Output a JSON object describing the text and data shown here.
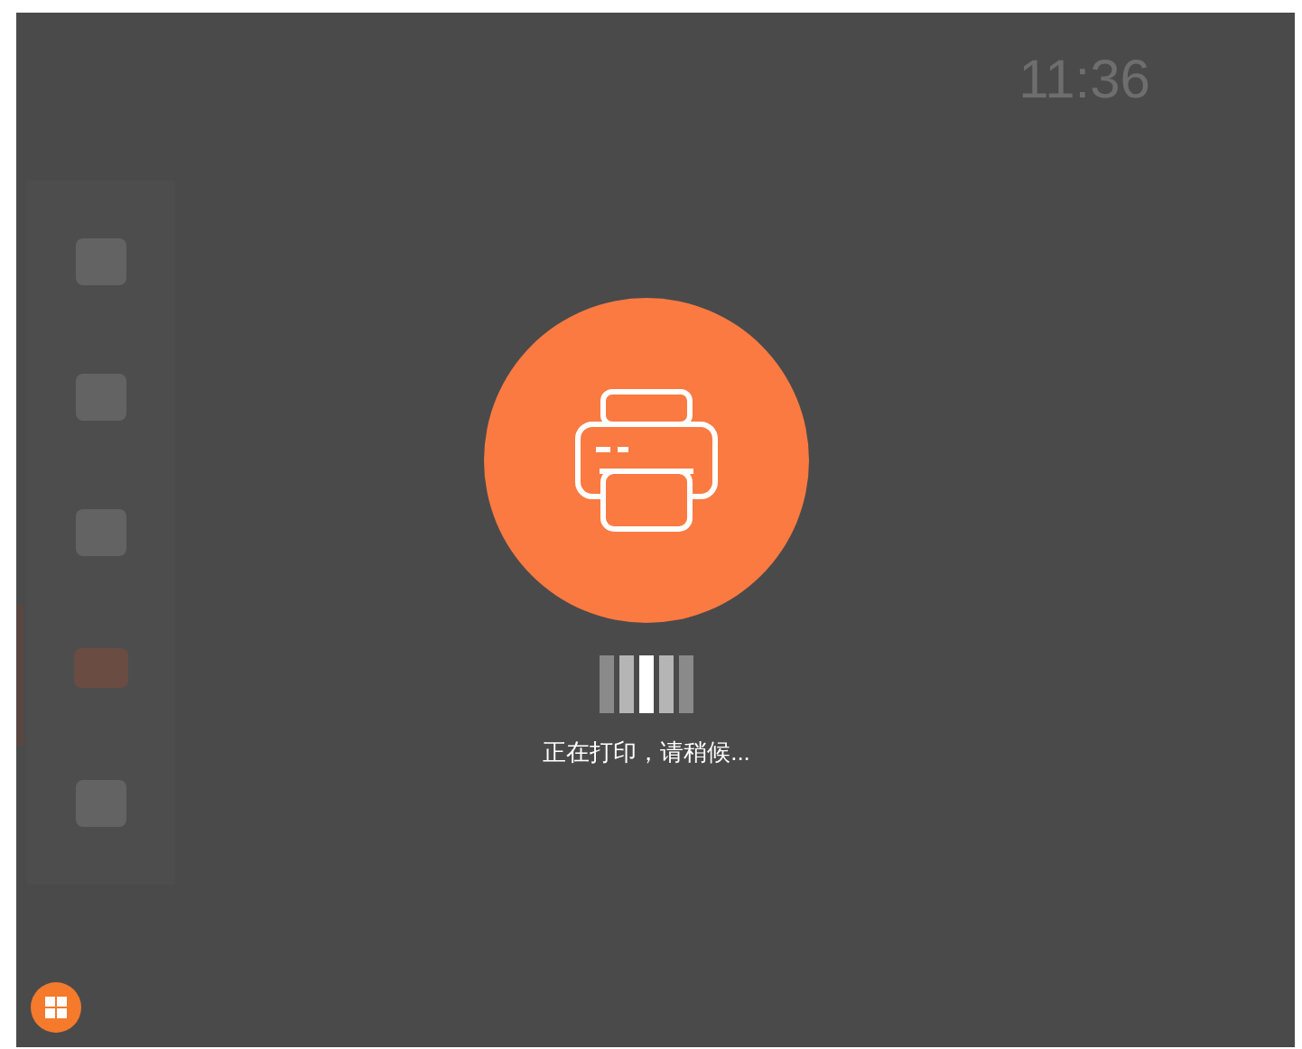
{
  "header": {
    "time": "11:36"
  },
  "sidebar": {
    "items": [
      {
        "selected": false
      },
      {
        "selected": false
      },
      {
        "selected": false
      },
      {
        "selected": true
      },
      {
        "selected": false
      }
    ]
  },
  "dialog": {
    "message": "正在打印，请稍候..."
  }
}
